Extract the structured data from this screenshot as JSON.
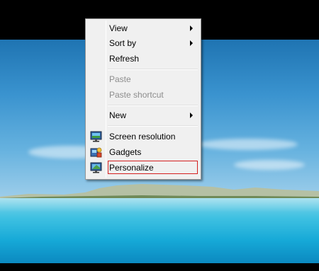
{
  "context_menu": {
    "items": [
      {
        "label": "View",
        "submenu": true,
        "enabled": true
      },
      {
        "label": "Sort by",
        "submenu": true,
        "enabled": true
      },
      {
        "label": "Refresh",
        "submenu": false,
        "enabled": true
      },
      {
        "label": "Paste",
        "submenu": false,
        "enabled": false
      },
      {
        "label": "Paste shortcut",
        "submenu": false,
        "enabled": false
      },
      {
        "label": "New",
        "submenu": true,
        "enabled": true
      },
      {
        "label": "Screen resolution",
        "submenu": false,
        "enabled": true,
        "icon": "monitor-icon"
      },
      {
        "label": "Gadgets",
        "submenu": false,
        "enabled": true,
        "icon": "gadgets-icon"
      },
      {
        "label": "Personalize",
        "submenu": false,
        "enabled": true,
        "icon": "personalize-icon",
        "highlighted": true
      }
    ]
  },
  "colors": {
    "menu_background": "#f0f0f0",
    "highlight_border": "#d41f1f",
    "disabled_text": "#8d8d8d"
  }
}
